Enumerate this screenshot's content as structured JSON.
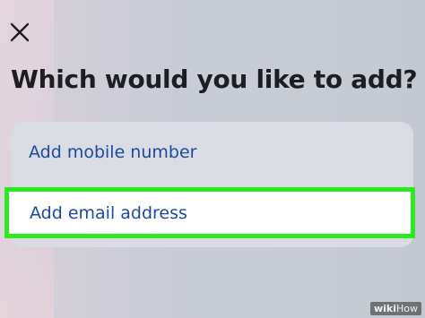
{
  "header": {
    "close_icon": "close-icon",
    "title": "Which would you like to add?"
  },
  "options": {
    "mobile_label": "Add mobile number",
    "email_label": "Add email address"
  },
  "highlight_color": "#2cea1e",
  "link_color": "#1c49a3",
  "watermark": {
    "brand": "wiki",
    "suffix": "How"
  }
}
